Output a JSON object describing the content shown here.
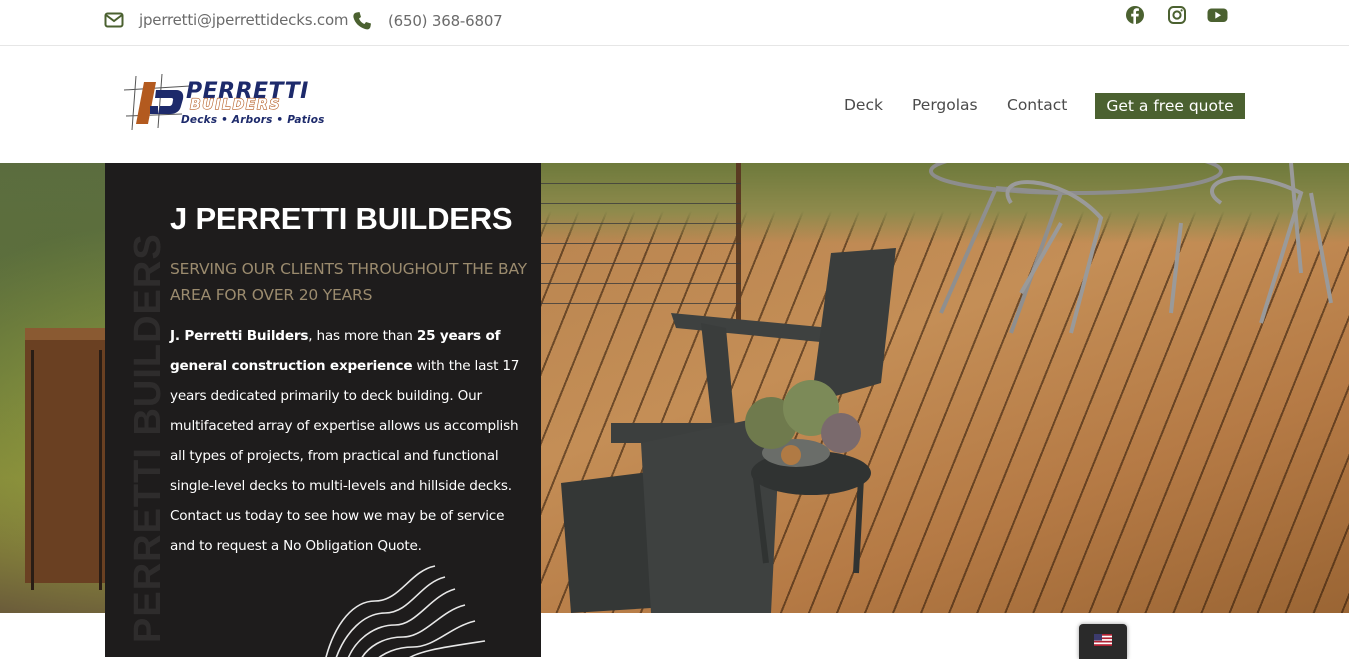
{
  "topbar": {
    "email": "jperretti@jperrettidecks.com",
    "phone": "(650) 368-6807",
    "icons": [
      "envelope-icon",
      "phone-icon",
      "facebook-icon",
      "instagram-icon",
      "youtube-icon"
    ]
  },
  "brand": {
    "logo_word1": "PERRETTI",
    "logo_word2": "BUILDERS",
    "logo_tagline": "Decks • Arbors • Patios"
  },
  "nav": {
    "items": [
      {
        "label": "Deck"
      },
      {
        "label": "Pergolas"
      },
      {
        "label": "Contact"
      }
    ],
    "cta_label": "Get a free quote"
  },
  "hero": {
    "vertical_text": "PERRETTI BUILDERS",
    "title": "J PERRETTI BUILDERS",
    "subtitle": "SERVING OUR CLIENTS THROUGHOUT THE BAY AREA FOR OVER 20 YEARS",
    "body_bold_1": "J. Perretti Builders",
    "body_1": ", has more than ",
    "body_bold_2": "25 years of general construction experience",
    "body_2": " with the last 17 years dedicated primarily to deck building. Our multifaceted array of expertise allows us accomplish all types of projects, from practical and functional single-level decks to multi-levels and hillside decks. Contact us today to see how we may be of service and to request a No Obligation Quote."
  },
  "language": {
    "flag": "us-flag-icon"
  },
  "colors": {
    "accent_green": "#4b6130",
    "icon_green": "#4b6130",
    "panel_bg": "#1e1c1c",
    "subtitle_tan": "#9b8b6e",
    "logo_navy": "#1d2a6b",
    "logo_orange": "#b35a1f"
  }
}
